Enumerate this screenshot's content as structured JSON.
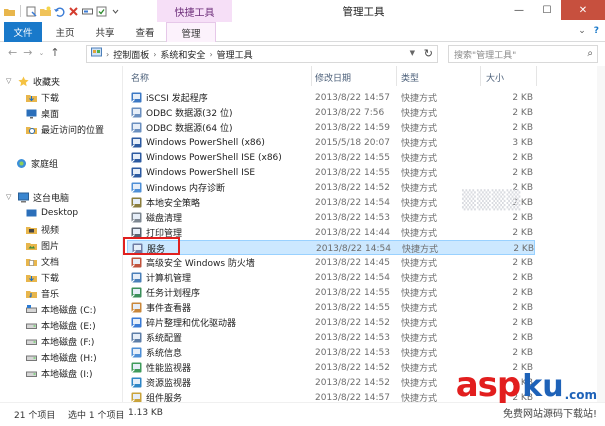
{
  "title_bar": {
    "contextual_tab": "快捷工具",
    "title": "管理工具",
    "minimize": "—",
    "maximize": "☐",
    "close": "✕"
  },
  "ribbon": {
    "tabs": [
      "文件",
      "主页",
      "共享",
      "查看",
      "管理"
    ],
    "help": "?"
  },
  "address": {
    "breadcrumbs": [
      "控制面板",
      "系统和安全",
      "管理工具"
    ],
    "search_placeholder": "搜索\"管理工具\""
  },
  "nav_pane": {
    "favorites_label": "收藏夹",
    "favorites": [
      "下载",
      "桌面",
      "最近访问的位置"
    ],
    "homegroup": "家庭组",
    "this_pc": "这台电脑",
    "pc_items": [
      "Desktop",
      "视频",
      "图片",
      "文档",
      "下载",
      "音乐",
      "本地磁盘 (C:)",
      "本地磁盘 (E:)",
      "本地磁盘 (F:)",
      "本地磁盘 (H:)",
      "本地磁盘 (I:)"
    ]
  },
  "columns": [
    "名称",
    "修改日期",
    "类型",
    "大小"
  ],
  "files": [
    {
      "name": "iSCSI 发起程序",
      "date": "2013/8/22 14:57",
      "type": "快捷方式",
      "size": "2 KB"
    },
    {
      "name": "ODBC 数据源(32 位)",
      "date": "2013/8/22 7:56",
      "type": "快捷方式",
      "size": "2 KB"
    },
    {
      "name": "ODBC 数据源(64 位)",
      "date": "2013/8/22 14:59",
      "type": "快捷方式",
      "size": "2 KB"
    },
    {
      "name": "Windows PowerShell (x86)",
      "date": "2015/5/18 20:07",
      "type": "快捷方式",
      "size": "3 KB"
    },
    {
      "name": "Windows PowerShell ISE (x86)",
      "date": "2013/8/22 14:55",
      "type": "快捷方式",
      "size": "2 KB"
    },
    {
      "name": "Windows PowerShell ISE",
      "date": "2013/8/22 14:55",
      "type": "快捷方式",
      "size": "2 KB"
    },
    {
      "name": "Windows 内存诊断",
      "date": "2013/8/22 14:52",
      "type": "快捷方式",
      "size": "2 KB"
    },
    {
      "name": "本地安全策略",
      "date": "2013/8/22 14:54",
      "type": "快捷方式",
      "size": "2 KB"
    },
    {
      "name": "磁盘清理",
      "date": "2013/8/22 14:53",
      "type": "快捷方式",
      "size": "2 KB"
    },
    {
      "name": "打印管理",
      "date": "2013/8/22 14:44",
      "type": "快捷方式",
      "size": "2 KB"
    },
    {
      "name": "服务",
      "date": "2013/8/22 14:54",
      "type": "快捷方式",
      "size": "2 KB"
    },
    {
      "name": "高级安全 Windows 防火墙",
      "date": "2013/8/22 14:45",
      "type": "快捷方式",
      "size": "2 KB"
    },
    {
      "name": "计算机管理",
      "date": "2013/8/22 14:54",
      "type": "快捷方式",
      "size": "2 KB"
    },
    {
      "name": "任务计划程序",
      "date": "2013/8/22 14:55",
      "type": "快捷方式",
      "size": "2 KB"
    },
    {
      "name": "事件查看器",
      "date": "2013/8/22 14:55",
      "type": "快捷方式",
      "size": "2 KB"
    },
    {
      "name": "碎片整理和优化驱动器",
      "date": "2013/8/22 14:52",
      "type": "快捷方式",
      "size": "2 KB"
    },
    {
      "name": "系统配置",
      "date": "2013/8/22 14:53",
      "type": "快捷方式",
      "size": "2 KB"
    },
    {
      "name": "系统信息",
      "date": "2013/8/22 14:53",
      "type": "快捷方式",
      "size": "2 KB"
    },
    {
      "name": "性能监视器",
      "date": "2013/8/22 14:52",
      "type": "快捷方式",
      "size": "2 KB"
    },
    {
      "name": "资源监视器",
      "date": "2013/8/22 14:52",
      "type": "快捷方式",
      "size": "2 KB"
    },
    {
      "name": "组件服务",
      "date": "2013/8/22 14:57",
      "type": "快捷方式",
      "size": "2 KB"
    }
  ],
  "selected_index": 10,
  "status": {
    "count": "21 个项目",
    "selection": "选中 1 个项目",
    "size": "1.13 KB"
  },
  "watermark": {
    "asp": "asp",
    "ku": "ku",
    "cn": ".com",
    "sub": "免费网站源码下载站!"
  },
  "colors": {
    "accent": "#1979ca",
    "context_tab": "#f6dff7",
    "selection": "#cce8ff",
    "highlight_box": "#e0201f",
    "close_button": "#c7503e"
  }
}
